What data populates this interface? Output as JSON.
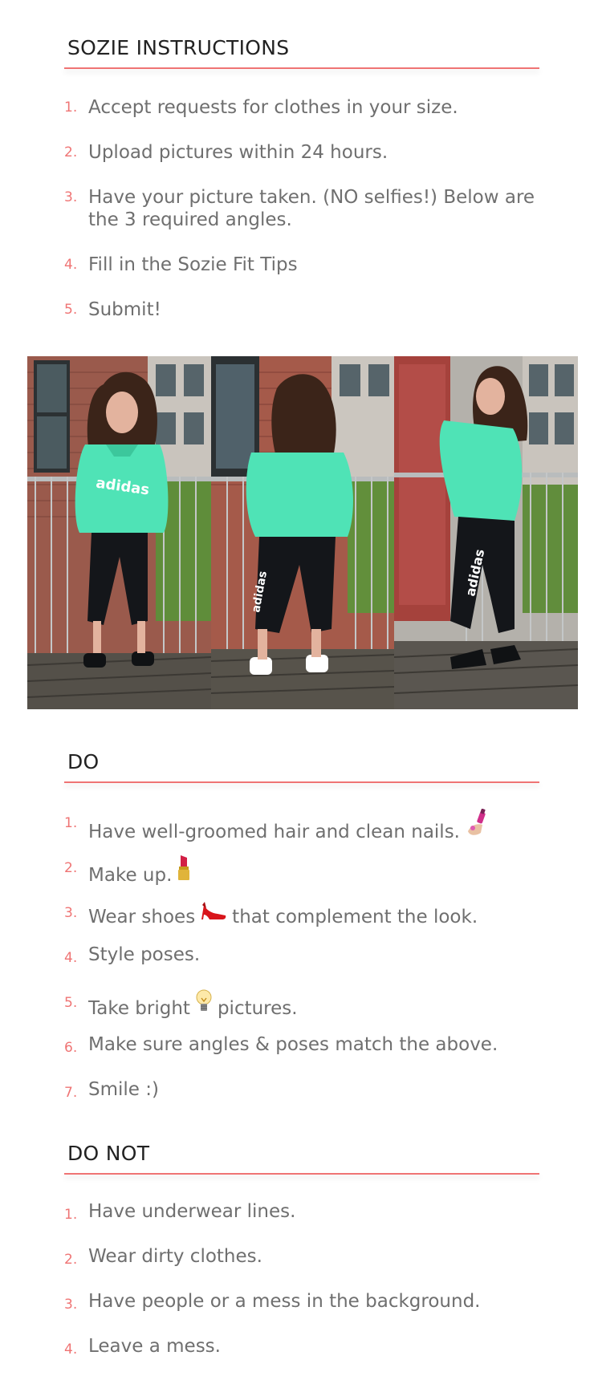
{
  "instructions": {
    "title": "SOZIE INSTRUCTIONS",
    "steps": [
      {
        "num": "1.",
        "text": "Accept requests for clothes in your size."
      },
      {
        "num": "2.",
        "text": "Upload pictures within 24 hours."
      },
      {
        "num": "3.",
        "text": "Have your picture taken. (NO selfies!) Below are the 3 required angles."
      },
      {
        "num": "4.",
        "text": "Fill in the Sozie Fit Tips"
      },
      {
        "num": "5.",
        "text": "Submit!"
      }
    ]
  },
  "photos": [
    {
      "name": "front-angle",
      "brand_text": "adidas"
    },
    {
      "name": "back-angle",
      "brand_text": "adidas"
    },
    {
      "name": "side-angle",
      "brand_text": "adidas"
    }
  ],
  "do": {
    "title": "DO",
    "items": [
      {
        "num": "1.",
        "text": "Have well-groomed hair and clean nails.",
        "emoji": "nail-polish-icon",
        "emoji_after": ""
      },
      {
        "num": "2.",
        "text": "Make up.",
        "emoji": "lipstick-icon",
        "emoji_after": ""
      },
      {
        "num": "3.",
        "text": "Wear shoes",
        "emoji": "high-heel-icon",
        "emoji_after": "that complement the look."
      },
      {
        "num": "4.",
        "text": "Style poses.",
        "emoji": "",
        "emoji_after": ""
      },
      {
        "num": "5.",
        "text": "Take bright",
        "emoji": "light-bulb-icon",
        "emoji_after": "pictures."
      },
      {
        "num": "6.",
        "text": "Make sure angles & poses match the above.",
        "emoji": "",
        "emoji_after": ""
      },
      {
        "num": "7.",
        "text": "Smile :)",
        "emoji": "",
        "emoji_after": ""
      }
    ]
  },
  "donot": {
    "title": "DO NOT",
    "items": [
      {
        "num": "1.",
        "text": "Have underwear lines."
      },
      {
        "num": "2.",
        "text": "Wear dirty clothes."
      },
      {
        "num": "3.",
        "text": "Have people or a mess in the background."
      },
      {
        "num": "4.",
        "text": "Leave a mess."
      }
    ]
  },
  "colors": {
    "accent": "#ef7474",
    "heading": "#222222",
    "body_text": "#6f6f6f",
    "sweatshirt": "#4fe3b6"
  }
}
